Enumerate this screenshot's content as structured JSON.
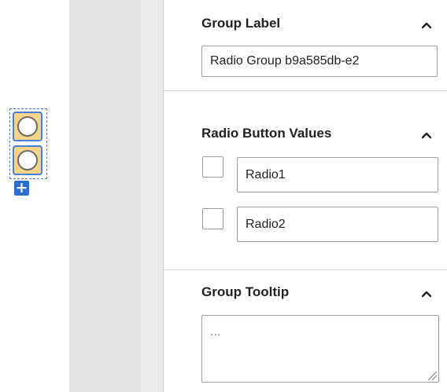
{
  "canvas": {
    "radio_widget": {
      "option_count": 2,
      "add_button_glyph": "+"
    }
  },
  "panel": {
    "group_label": {
      "title": "Group Label",
      "value": "Radio Group b9a585db-e2",
      "collapse_icon": "chevron-up-icon"
    },
    "radio_values": {
      "title": "Radio Button Values",
      "collapse_icon": "chevron-up-icon",
      "items": [
        {
          "checked": false,
          "value": "Radio1"
        },
        {
          "checked": false,
          "value": "Radio2"
        }
      ]
    },
    "group_tooltip": {
      "title": "Group Tooltip",
      "collapse_icon": "chevron-up-icon",
      "placeholder": "..."
    }
  },
  "colors": {
    "selection_blue": "#4a7fd6",
    "radio_fill": "#f6d58a",
    "add_button": "#2f6dd0",
    "gutter": "#ececec"
  }
}
